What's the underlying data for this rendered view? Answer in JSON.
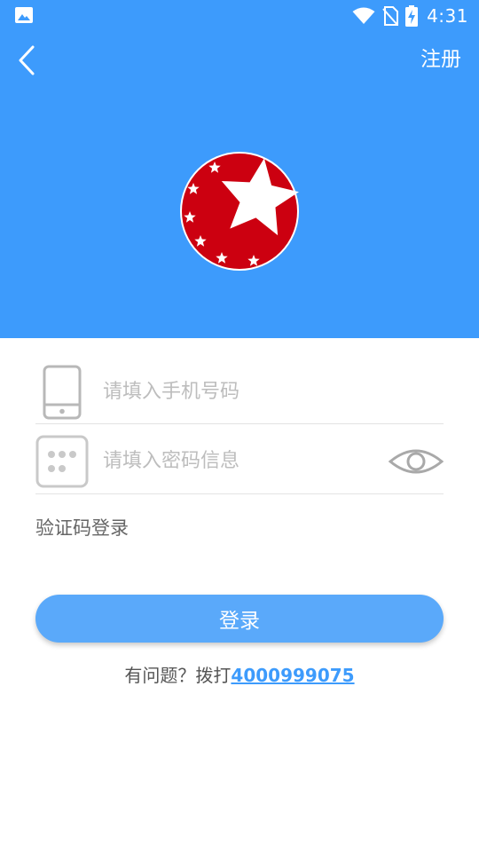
{
  "status_bar": {
    "time": "4:31",
    "icons": [
      "image-icon",
      "wifi-icon",
      "no-sim-icon",
      "battery-charging-icon"
    ]
  },
  "header": {
    "back_icon": "chevron-left-icon",
    "register_label": "注册",
    "logo_icon": "red-star-logo-icon"
  },
  "form": {
    "phone": {
      "icon": "phone-icon",
      "value": "",
      "placeholder": "请填入手机号码"
    },
    "password": {
      "icon": "keypad-icon",
      "value": "",
      "placeholder": "请填入密码信息",
      "toggle_icon": "eye-icon"
    },
    "sms_login_label": "验证码登录",
    "login_label": "登录"
  },
  "help": {
    "prefix": "有问题？拨打",
    "phone": "4000999075"
  },
  "colors": {
    "header_bg": "#3d9bfc",
    "button_bg": "#5aa9fa",
    "link": "#3d9bfc",
    "logo_red": "#cc0010"
  }
}
